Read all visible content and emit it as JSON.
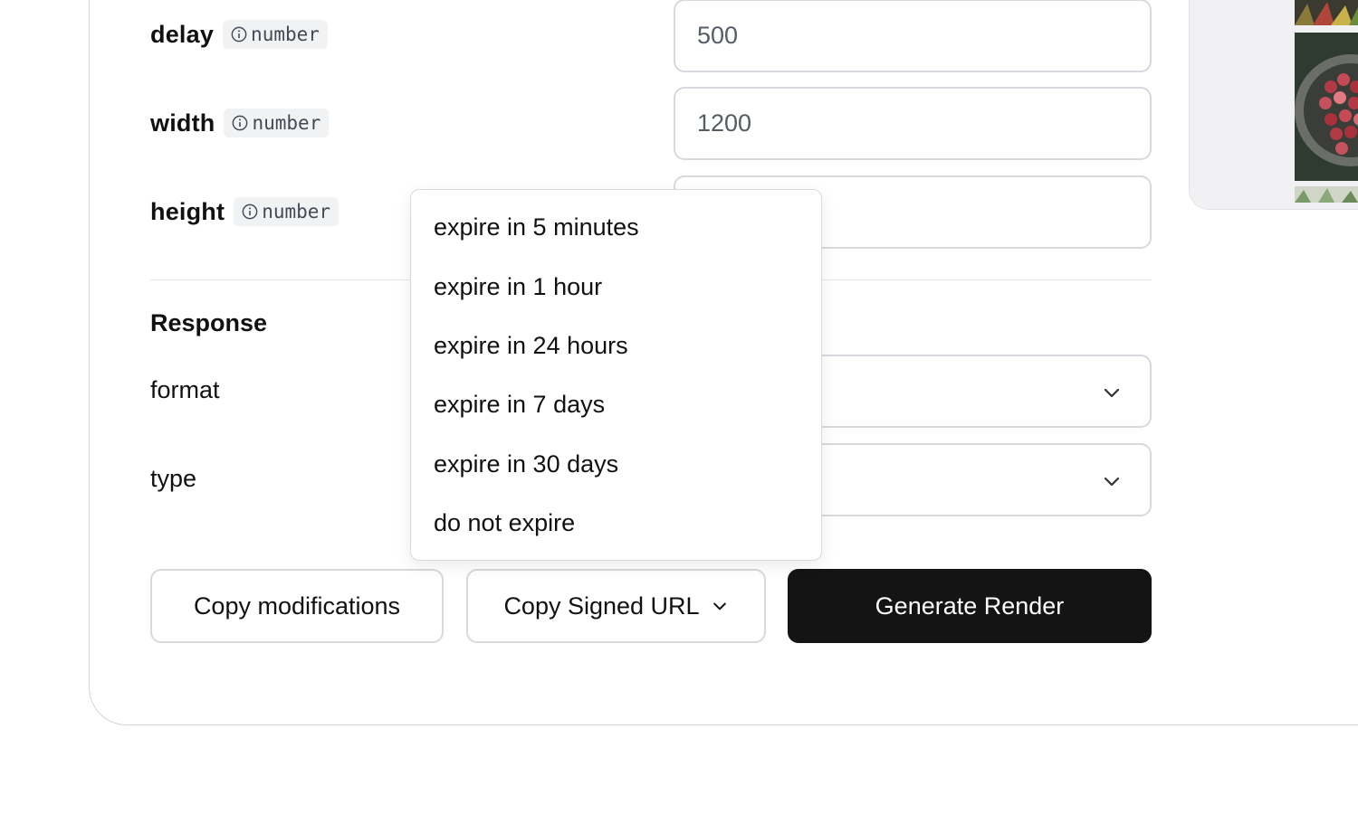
{
  "params": [
    {
      "name": "delay",
      "type": "number",
      "value": "500"
    },
    {
      "name": "width",
      "type": "number",
      "value": "1200"
    },
    {
      "name": "height",
      "type": "number",
      "value": ""
    }
  ],
  "response": {
    "title": "Response",
    "format_label": "format",
    "format_value": "",
    "type_label": "type",
    "type_value": ""
  },
  "buttons": {
    "copy_modifications": "Copy modifications",
    "copy_signed_url": "Copy Signed URL",
    "generate_render": "Generate Render"
  },
  "expiry_menu": {
    "items": [
      "expire in 5 minutes",
      "expire in 1 hour",
      "expire in 24 hours",
      "expire in 7 days",
      "expire in 30 days",
      "do not expire"
    ]
  },
  "icons": {
    "info": "info-circle-icon",
    "chevron": "chevron-down-icon"
  },
  "colors": {
    "primary_button": "#141414",
    "border": "#d8d8de",
    "badge_bg": "#f1f2f4"
  }
}
